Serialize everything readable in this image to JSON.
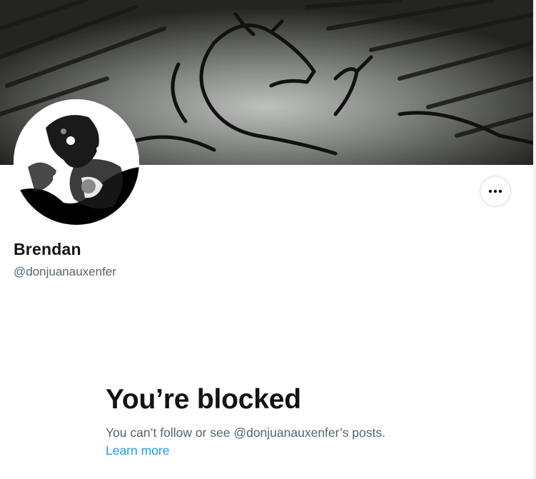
{
  "profile": {
    "display_name": "Brendan",
    "handle": "@donjuanauxenfer",
    "banner_icon": "banner-image",
    "avatar_icon": "avatar-image"
  },
  "actions": {
    "more_icon": "more-horizontal-icon"
  },
  "blocked": {
    "title": "You’re blocked",
    "message": "You can’t follow or see @donjuanauxenfer’s posts.",
    "learn_more": "Learn more"
  },
  "colors": {
    "text_primary": "#0f1419",
    "text_secondary": "#536471",
    "link": "#1d9bf0",
    "border": "#cfd9de"
  }
}
